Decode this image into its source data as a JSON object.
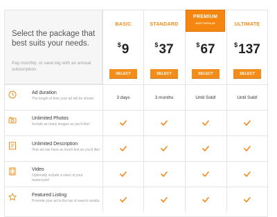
{
  "intro": {
    "title": "Select the package that best suits your needs.",
    "subtitle": "Pay monthly, or save big with an annual subscription."
  },
  "plans": [
    {
      "name": "BASIC",
      "currency": "$",
      "price": "9",
      "button": "SELECT"
    },
    {
      "name": "STANDARD",
      "currency": "$",
      "price": "37",
      "button": "SELECT"
    },
    {
      "name": "PREMIUM",
      "badge": "MOST POPULAR",
      "currency": "$",
      "price": "67",
      "button": "SELECT"
    },
    {
      "name": "ULTIMATE",
      "currency": "$",
      "price": "137",
      "button": "SELECT"
    }
  ],
  "features": [
    {
      "icon": "clock-icon",
      "title": "Ad duration",
      "desc": "The length of time your ad will be shown.",
      "values": [
        "3 days",
        "3 months",
        "Until Sold!",
        "Until Sold!"
      ]
    },
    {
      "icon": "camera-icon",
      "title": "Unlimited Photos",
      "desc": "Include as many images as you'd like!",
      "values": [
        true,
        true,
        true,
        true
      ]
    },
    {
      "icon": "document-icon",
      "title": "Unlimited Description",
      "desc": "Your ad can have as much text as you'd like!",
      "values": [
        true,
        true,
        true,
        true
      ]
    },
    {
      "icon": "film-icon",
      "title": "Video",
      "desc": "Optionally include a video of your motorcycle!",
      "values": [
        true,
        true,
        true,
        true
      ]
    },
    {
      "icon": "star-icon",
      "title": "Featured Listing",
      "desc": "Promote your ad to the top of search results.",
      "values": [
        true,
        true,
        true,
        true
      ]
    }
  ],
  "colors": {
    "accent": "#f28c1b",
    "premium": "#f5860f"
  }
}
